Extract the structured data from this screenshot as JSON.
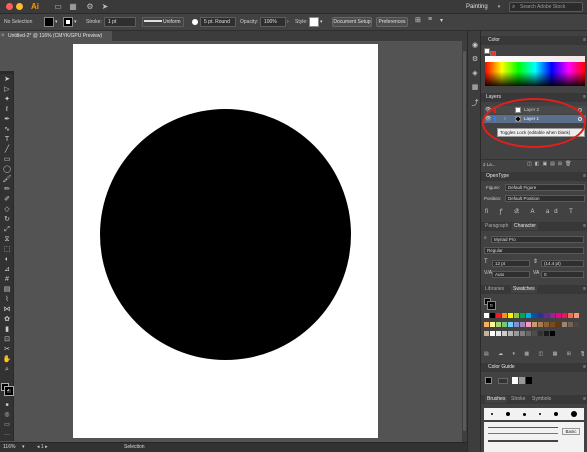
{
  "window": {
    "app_logo": "Ai",
    "workspace": "Painting",
    "search_placeholder": "Search Adobe Stock",
    "traffic_lights": [
      "#ff5f57",
      "#febc2e",
      "#28c840"
    ]
  },
  "control_bar": {
    "selection_label": "No Selection",
    "stroke_label": "Stroke:",
    "stroke_weight": "1 pt",
    "profile": "Uniform",
    "brush": "5 pt. Round",
    "opacity_label": "Opacity:",
    "opacity_value": "100%",
    "style_label": "Style:",
    "document_setup": "Document Setup",
    "preferences": "Preferences"
  },
  "document": {
    "tab_title": "Untitled-2* @ 116% (CMYK/GPU Preview)",
    "shape": "circle",
    "fill_color": "#000000"
  },
  "status_bar": {
    "zoom": "116%",
    "tool_name": "Selection"
  },
  "toolbar": {
    "tools": [
      "selection-tool",
      "direct-selection-tool",
      "magic-wand-tool",
      "lasso-tool",
      "pen-tool",
      "curvature-tool",
      "type-tool",
      "line-tool",
      "rectangle-tool",
      "ellipse-tool",
      "paintbrush-tool",
      "pencil-tool",
      "shaper-tool",
      "eraser-tool",
      "rotate-tool",
      "scale-tool",
      "width-tool",
      "free-transform-tool",
      "shape-builder-tool",
      "perspective-grid-tool",
      "mesh-tool",
      "gradient-tool",
      "eyedropper-tool",
      "blend-tool",
      "symbol-sprayer-tool",
      "column-graph-tool",
      "artboard-tool",
      "slice-tool",
      "hand-tool",
      "zoom-tool"
    ]
  },
  "panels": {
    "color": {
      "title": "Color"
    },
    "layers": {
      "title": "Layers",
      "items": [
        {
          "name": "Layer 2"
        },
        {
          "name": "Layer 1"
        }
      ],
      "tooltip": "Toggles Lock (editable when blank)",
      "count_label": "2 La..."
    },
    "opentype": {
      "title": "OpenType",
      "figure_label": "Figure:",
      "figure_value": "Default Figure",
      "position_label": "Position:",
      "position_value": "Default Position"
    },
    "character": {
      "tabs": [
        "Paragraph",
        "Character"
      ],
      "font": "Myriad Pro",
      "style": "Regular",
      "size": "12 pt",
      "leading": "(14.4 pt)",
      "kerning": "Auto",
      "tracking": "0"
    },
    "swatches": {
      "tabs": [
        "Libraries",
        "Swatches"
      ],
      "colors": [
        "#ffffff",
        "#000000",
        "#ed1c24",
        "#f7941d",
        "#fff200",
        "#8dc63f",
        "#00a651",
        "#00aeef",
        "#0054a6",
        "#2e3192",
        "#662d91",
        "#92278f",
        "#ec008c",
        "#ed145b",
        "#f26c4f",
        "#f69679",
        "#fbaf5d",
        "#fff799",
        "#acd373",
        "#7cc576",
        "#6dcff6",
        "#8393ca",
        "#a186be",
        "#f49ac1",
        "#c69c6d",
        "#a67c52",
        "#8c6239",
        "#754c24",
        "#603913",
        "#998675",
        "#736357",
        "#534741",
        "#c7b299",
        "#ffffff",
        "#e6e6e6",
        "#cccccc",
        "#b3b3b3",
        "#999999",
        "#808080",
        "#666666",
        "#4d4d4d",
        "#333333",
        "#1a1a1a",
        "#000000"
      ]
    },
    "color_guide": {
      "title": "Color Guide"
    },
    "brushes": {
      "tabs": [
        "Brushes",
        "Stroke",
        "Symbols"
      ],
      "basic_label": "Basic"
    }
  },
  "annotation": {
    "color": "#e0201b"
  }
}
